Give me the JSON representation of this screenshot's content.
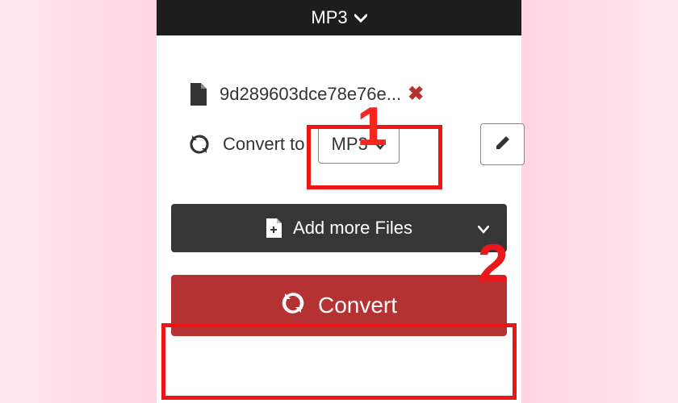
{
  "topBar": {
    "format": "MP3"
  },
  "file": {
    "name": "9d289603dce78e76e...",
    "convertLabel": "Convert to",
    "targetFormat": "MP3"
  },
  "buttons": {
    "addMore": "Add more Files",
    "convert": "Convert"
  },
  "annotations": {
    "step1": "1",
    "step2": "2"
  }
}
